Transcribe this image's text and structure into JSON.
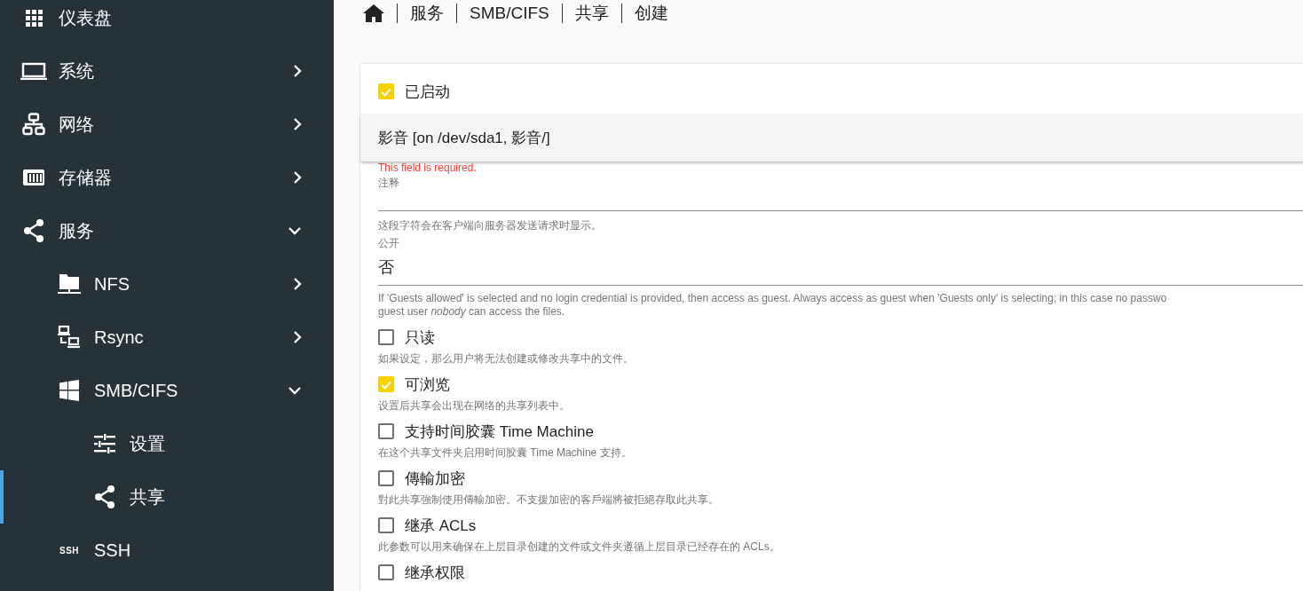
{
  "sidebar": {
    "items": [
      {
        "label": "仪表盘",
        "kind": "grid",
        "selected": false
      },
      {
        "label": "系统",
        "kind": "laptop",
        "expanded": false,
        "selected": false
      },
      {
        "label": "网络",
        "kind": "network",
        "expanded": false,
        "selected": false
      },
      {
        "label": "存储器",
        "kind": "storage",
        "expanded": false,
        "selected": false
      },
      {
        "label": "服务",
        "kind": "share",
        "expanded": true,
        "selected": false,
        "children": [
          {
            "label": "NFS",
            "kind": "folder",
            "expanded": false,
            "selected": false
          },
          {
            "label": "Rsync",
            "kind": "computers",
            "expanded": false,
            "selected": false
          },
          {
            "label": "SMB/CIFS",
            "kind": "windows",
            "expanded": true,
            "selected": false,
            "children": [
              {
                "label": "设置",
                "kind": "sliders",
                "selected": false
              },
              {
                "label": "共享",
                "kind": "share",
                "selected": true
              }
            ]
          },
          {
            "label": "SSH",
            "kind": "text",
            "icon_text": "SSH",
            "selected": false
          }
        ]
      }
    ]
  },
  "breadcrumb": [
    "服务",
    "SMB/CIFS",
    "共享",
    "创建"
  ],
  "form": {
    "enabled": {
      "label": "已启动",
      "checked": true
    },
    "shared_folder": {
      "error": "This field is required.",
      "menu_option": "影音 [on /dev/sda1, 影音/]"
    },
    "comment": {
      "label": "注释",
      "hint": "这段字符会在客户端向服务器发送请求时显示。"
    },
    "public": {
      "label": "公开",
      "value": "否",
      "hint_lines": [
        "If 'Guests allowed' is selected and no login credential is provided, then access as guest. Always access as guest when 'Guests only' is selecting; in this case no passwo",
        "guest user *nobody* can access the files."
      ]
    },
    "options": [
      {
        "label": "只读",
        "checked": false,
        "hint": "如果设定，那么用户将无法创建或修改共享中的文件。"
      },
      {
        "label": "可浏览",
        "checked": true,
        "hint": "设置后共享会出现在网络的共享列表中。"
      },
      {
        "label": "支持时间胶囊 Time Machine",
        "checked": false,
        "hint": "在这个共享文件夹启用时间胶囊 Time Machine 支持。"
      },
      {
        "label": "傳輸加密",
        "checked": false,
        "hint": "對此共享強制使用傳輸加密。不支援加密的客戶端將被拒絕存取此共享。"
      },
      {
        "label": "继承 ACLs",
        "checked": false,
        "hint": "此参数可以用来确保在上层目录创建的文件或文件夹遵循上层目录已经存在的 ACLs。"
      },
      {
        "label": "继承权限",
        "checked": false
      }
    ]
  }
}
